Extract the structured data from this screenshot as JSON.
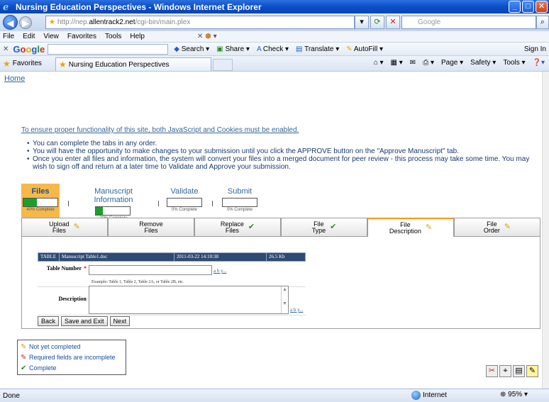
{
  "window": {
    "title": "Nursing Education Perspectives - Windows Internet Explorer"
  },
  "address": {
    "url_prefix": "http://nep.",
    "url_domain": "allentrack2.net",
    "url_path": "/cgi-bin/main.plex",
    "search_placeholder": "Google"
  },
  "menu": [
    "File",
    "Edit",
    "View",
    "Favorites",
    "Tools",
    "Help"
  ],
  "gtoolbar": {
    "search_label": "Search",
    "share": "Share",
    "check": "Check",
    "translate": "Translate",
    "autofill": "AutoFill",
    "signin": "Sign In"
  },
  "favbar": {
    "favorites": "Favorites",
    "tab_title": "Nursing Education Perspectives",
    "page": "Page",
    "safety": "Safety",
    "tools": "Tools"
  },
  "page": {
    "home": "Home",
    "warning": "To ensure proper functionality of this site, both JavaScript and Cookies must be enabled.",
    "bullets": [
      "You can complete the tabs in any order.",
      "You will have the opportunity to make changes to your submission until you click the APPROVE button on the \"Approve Manuscript\" tab.",
      "Once you enter all files and information, the system will convert your files into a merged document for peer review - this process may take some time. You may wish to sign off and return at a later time to Validate and Approve your submission."
    ],
    "steps": [
      {
        "title": "Files",
        "label": "40% Complete",
        "progress": 0.4
      },
      {
        "title": "Manuscript Information",
        "label": "20% Complete",
        "progress": 0.2
      },
      {
        "title": "Validate",
        "label": "0% Complete",
        "progress": 0
      },
      {
        "title": "Submit",
        "label": "0% Complete",
        "progress": 0
      }
    ],
    "subtabs": [
      {
        "line1": "Upload",
        "line2": "Files",
        "state": "pending"
      },
      {
        "line1": "Remove",
        "line2": "Files",
        "state": "none"
      },
      {
        "line1": "Replace",
        "line2": "Files",
        "state": "complete"
      },
      {
        "line1": "File",
        "line2": "Type",
        "state": "complete"
      },
      {
        "line1": "File",
        "line2": "Description",
        "state": "pending"
      },
      {
        "line1": "File",
        "line2": "Order",
        "state": "pending"
      }
    ],
    "file_row": {
      "type": "TABLE",
      "name": "Manuscript Table1.doc",
      "date": "2011-03-22 14:10:38",
      "size": "26.5 Kb"
    },
    "table_number_label": "Table Number",
    "required_mark": "*",
    "spell_link": "a b y...",
    "example": "Example: Table 1, Table 2, Table 2A, or Table 2B, etc.",
    "description_label": "Description",
    "buttons": {
      "back": "Back",
      "save_exit": "Save and Exit",
      "next": "Next"
    },
    "legend": {
      "not_completed": "Not yet completed",
      "incomplete": "Required fields are incomplete",
      "complete": "Complete"
    }
  },
  "status": {
    "left": "Done",
    "zone": "Internet",
    "zoom": "95%"
  }
}
